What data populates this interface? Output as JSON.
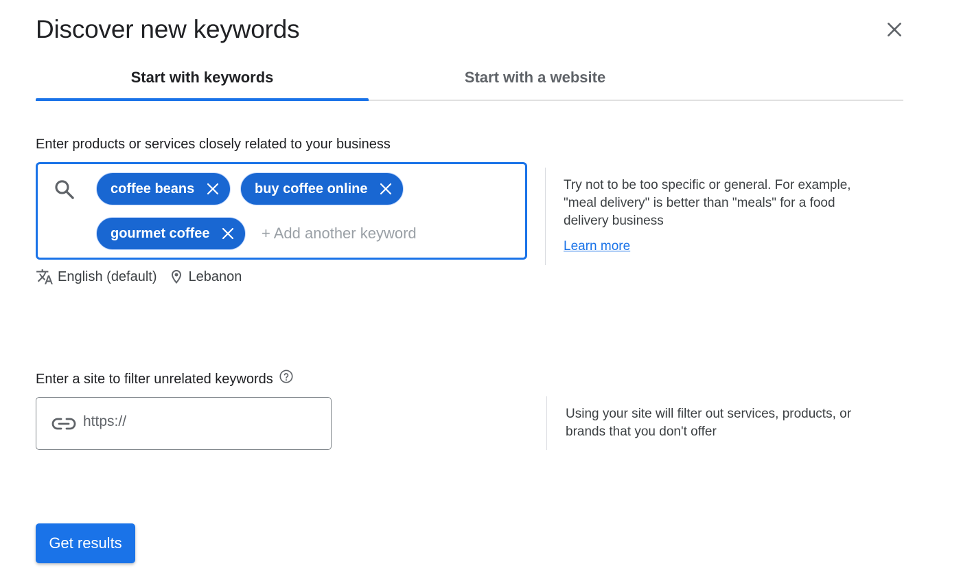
{
  "dialog": {
    "title": "Discover new keywords"
  },
  "tabs": [
    {
      "label": "Start with keywords",
      "selected": true
    },
    {
      "label": "Start with a website",
      "selected": false
    }
  ],
  "keywords_section": {
    "label": "Enter products or services closely related to your business",
    "chips": [
      {
        "label": "coffee beans"
      },
      {
        "label": "buy coffee online"
      },
      {
        "label": "gourmet coffee"
      }
    ],
    "add_placeholder": "+ Add another keyword",
    "language": "English (default)",
    "location": "Lebanon",
    "help_text": "Try not to be too specific or general. For example, \"meal delivery\" is better than \"meals\" for a food delivery business",
    "learn_more": "Learn more"
  },
  "site_section": {
    "label": "Enter a site to filter unrelated keywords",
    "placeholder": "https://",
    "help_text": "Using your site will filter out services, products, or brands that you don't offer"
  },
  "actions": {
    "get_results": "Get results"
  },
  "colors": {
    "accent": "#1a73e8",
    "chip": "#1967d2",
    "text": "#202124",
    "muted": "#5f6368"
  }
}
